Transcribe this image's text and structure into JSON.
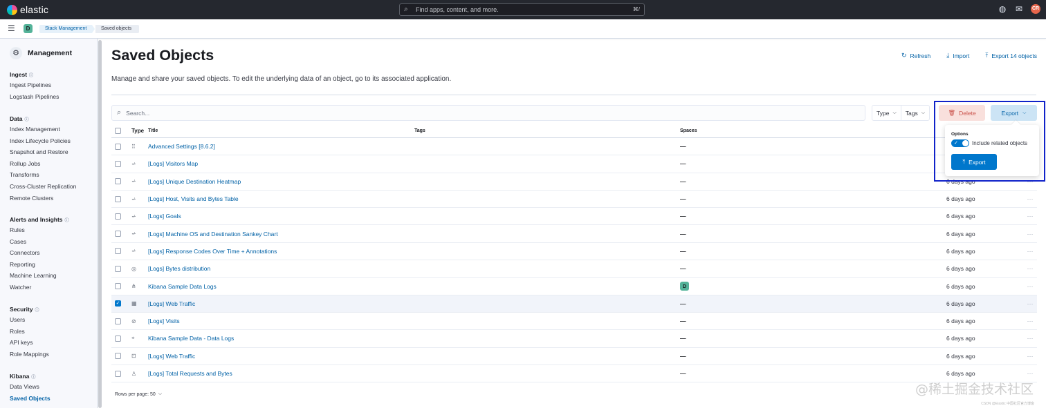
{
  "header": {
    "brand": "elastic",
    "search_placeholder": "Find apps, content, and more.",
    "search_shortcut": "⌘/",
    "avatar_initials": "CR"
  },
  "breadcrumbs": {
    "space_initial": "D",
    "items": [
      "Stack Management",
      "Saved objects"
    ]
  },
  "sidebar": {
    "title": "Management",
    "groups": [
      {
        "label": "Ingest",
        "items": [
          "Ingest Pipelines",
          "Logstash Pipelines"
        ]
      },
      {
        "label": "Data",
        "items": [
          "Index Management",
          "Index Lifecycle Policies",
          "Snapshot and Restore",
          "Rollup Jobs",
          "Transforms",
          "Cross-Cluster Replication",
          "Remote Clusters"
        ]
      },
      {
        "label": "Alerts and Insights",
        "items": [
          "Rules",
          "Cases",
          "Connectors",
          "Reporting",
          "Machine Learning",
          "Watcher"
        ]
      },
      {
        "label": "Security",
        "items": [
          "Users",
          "Roles",
          "API keys",
          "Role Mappings"
        ]
      },
      {
        "label": "Kibana",
        "items": [
          "Data Views",
          "Saved Objects"
        ]
      }
    ],
    "active_item": "Saved Objects"
  },
  "page": {
    "title": "Saved Objects",
    "description": "Manage and share your saved objects. To edit the underlying data of an object, go to its associated application.",
    "actions": {
      "refresh": "Refresh",
      "import": "Import",
      "export_all": "Export 14 objects"
    }
  },
  "toolbar": {
    "search_placeholder": "Search...",
    "filter_type": "Type",
    "filter_tags": "Tags",
    "delete_label": "Delete",
    "export_label": "Export"
  },
  "table": {
    "columns": {
      "type": "Type",
      "title": "Title",
      "tags": "Tags",
      "spaces": "Spaces"
    },
    "rows": [
      {
        "icon": "advanced-settings-icon",
        "glyph": "⠿",
        "title": "Advanced Settings [8.6.2]",
        "spaces": "—",
        "updated": "",
        "checked": false
      },
      {
        "icon": "visualization-icon",
        "glyph": "⩫",
        "title": "[Logs] Visitors Map",
        "spaces": "—",
        "updated": "",
        "checked": false
      },
      {
        "icon": "visualization-icon",
        "glyph": "⩫",
        "title": "[Logs] Unique Destination Heatmap",
        "spaces": "—",
        "updated": "6 days ago",
        "checked": false
      },
      {
        "icon": "visualization-icon",
        "glyph": "⩫",
        "title": "[Logs] Host, Visits and Bytes Table",
        "spaces": "—",
        "updated": "6 days ago",
        "checked": false
      },
      {
        "icon": "visualization-icon",
        "glyph": "⩫",
        "title": "[Logs] Goals",
        "spaces": "—",
        "updated": "6 days ago",
        "checked": false
      },
      {
        "icon": "visualization-icon",
        "glyph": "⩫",
        "title": "[Logs] Machine OS and Destination Sankey Chart",
        "spaces": "—",
        "updated": "6 days ago",
        "checked": false
      },
      {
        "icon": "visualization-icon",
        "glyph": "⩫",
        "title": "[Logs] Response Codes Over Time + Annotations",
        "spaces": "—",
        "updated": "6 days ago",
        "checked": false
      },
      {
        "icon": "lens-icon",
        "glyph": "◎",
        "title": "[Logs] Bytes distribution",
        "spaces": "—",
        "updated": "6 days ago",
        "checked": false
      },
      {
        "icon": "index-pattern-icon",
        "glyph": "⋔",
        "title": "Kibana Sample Data Logs",
        "spaces": "D",
        "updated": "6 days ago",
        "checked": false
      },
      {
        "icon": "dashboard-icon",
        "glyph": "▦",
        "title": "[Logs] Web Traffic",
        "spaces": "—",
        "updated": "6 days ago",
        "checked": true
      },
      {
        "icon": "search-session-icon",
        "glyph": "⊘",
        "title": "[Logs] Visits",
        "spaces": "—",
        "updated": "6 days ago",
        "checked": false
      },
      {
        "icon": "tag-icon",
        "glyph": "⌖",
        "title": "Kibana Sample Data - Data Logs",
        "spaces": "—",
        "updated": "6 days ago",
        "checked": false
      },
      {
        "icon": "map-icon",
        "glyph": "⊡",
        "title": "[Logs] Web Traffic",
        "spaces": "—",
        "updated": "6 days ago",
        "checked": false
      },
      {
        "icon": "canvas-icon",
        "glyph": "♙",
        "title": "[Logs] Total Requests and Bytes",
        "spaces": "—",
        "updated": "6 days ago",
        "checked": false
      }
    ],
    "rows_per_page": "Rows per page: 50"
  },
  "export_popover": {
    "options_label": "Options",
    "toggle_label": "Include related objects",
    "toggle_on": true,
    "button_label": "Export"
  },
  "watermark": {
    "text": "@稀土掘金技术社区",
    "small": "CSDN @Elastic 中国社区官方博客"
  },
  "colors": {
    "header_bg": "#25282f",
    "link": "#0061a6",
    "primary": "#0077cc",
    "danger": "#bd271e",
    "space_badge": "#54b399",
    "highlight_box": "#1022c9"
  }
}
